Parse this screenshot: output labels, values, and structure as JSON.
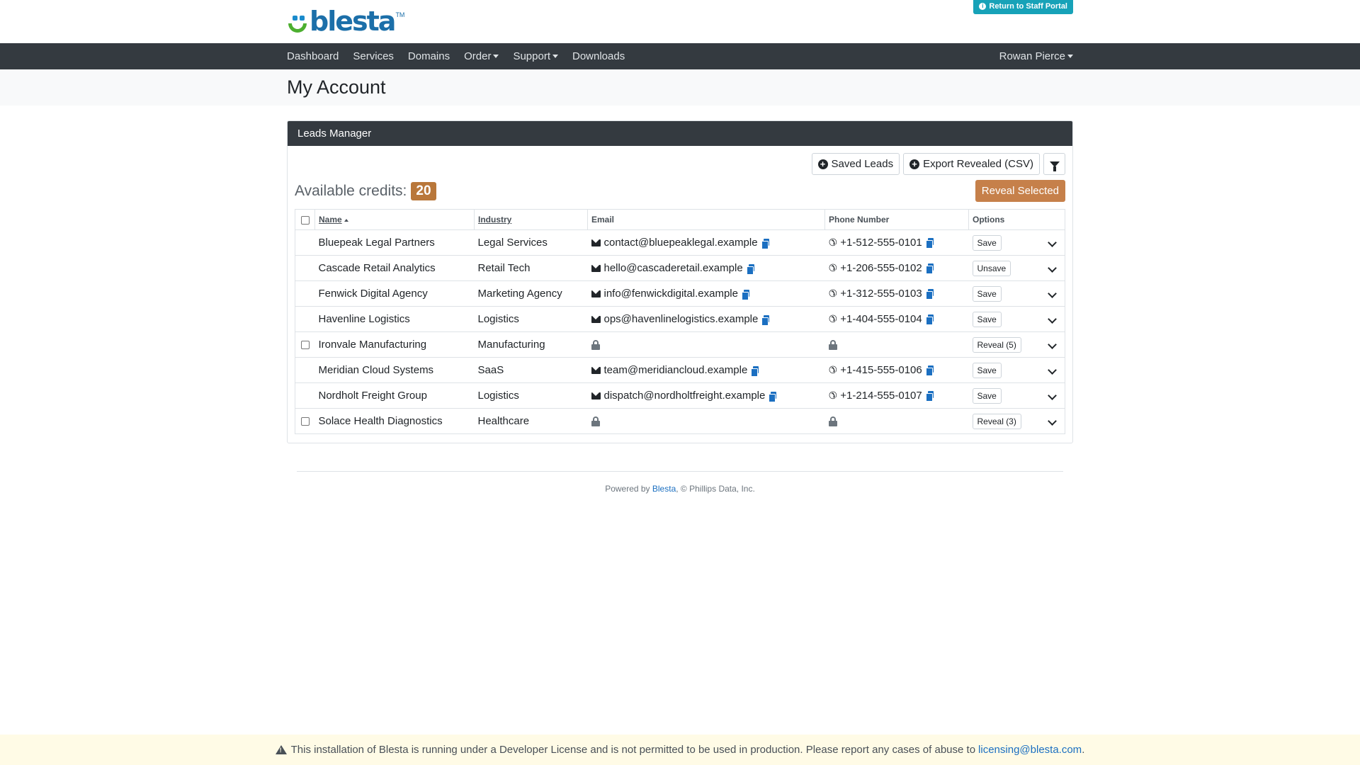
{
  "brand": {
    "name": "blesta",
    "tm": "TM"
  },
  "header": {
    "staff_button": "Return to Staff Portal"
  },
  "nav": {
    "items": [
      "Dashboard",
      "Services",
      "Domains",
      "Order",
      "Support",
      "Downloads"
    ],
    "user": "Rowan Pierce"
  },
  "page": {
    "title": "My Account"
  },
  "leads": {
    "card_title": "Leads Manager",
    "saved_leads": "Saved Leads",
    "export": "Export Revealed (CSV)",
    "credits_label": "Available credits:",
    "credits_value": "20",
    "reveal_selected": "Reveal Selected",
    "columns": {
      "name": "Name",
      "industry": "Industry",
      "email": "Email",
      "phone": "Phone Number",
      "options": "Options"
    },
    "rows": [
      {
        "name": "Bluepeak Legal Partners",
        "industry": "Legal Services",
        "email": "contact@bluepeaklegal.example",
        "phone": "+1-512-555-0101",
        "action": "Save",
        "locked": false
      },
      {
        "name": "Cascade Retail Analytics",
        "industry": "Retail Tech",
        "email": "hello@cascaderetail.example",
        "phone": "+1-206-555-0102",
        "action": "Unsave",
        "locked": false
      },
      {
        "name": "Fenwick Digital Agency",
        "industry": "Marketing Agency",
        "email": "info@fenwickdigital.example",
        "phone": "+1-312-555-0103",
        "action": "Save",
        "locked": false
      },
      {
        "name": "Havenline Logistics",
        "industry": "Logistics",
        "email": "ops@havenlinelogistics.example",
        "phone": "+1-404-555-0104",
        "action": "Save",
        "locked": false
      },
      {
        "name": "Ironvale Manufacturing",
        "industry": "Manufacturing",
        "email": "",
        "phone": "",
        "action": "Reveal (5)",
        "locked": true
      },
      {
        "name": "Meridian Cloud Systems",
        "industry": "SaaS",
        "email": "team@meridiancloud.example",
        "phone": "+1-415-555-0106",
        "action": "Save",
        "locked": false
      },
      {
        "name": "Nordholt Freight Group",
        "industry": "Logistics",
        "email": "dispatch@nordholtfreight.example",
        "phone": "+1-214-555-0107",
        "action": "Save",
        "locked": false
      },
      {
        "name": "Solace Health Diagnostics",
        "industry": "Healthcare",
        "email": "",
        "phone": "",
        "action": "Reveal (3)",
        "locked": true
      }
    ]
  },
  "footer": {
    "powered_prefix": "Powered by ",
    "powered_link": "Blesta",
    "powered_suffix": ", © Phillips Data, Inc."
  },
  "dev_notice": {
    "text": "This installation of Blesta is running under a Developer License and is not permitted to be used in production. Please report any cases of abuse to",
    "email": "licensing@blesta.com",
    "end": "."
  },
  "colors": {
    "nav_bg": "#343a40",
    "accent": "#c6804a",
    "info": "#17a2b8",
    "link": "#1b6fc1"
  },
  "icons": [
    "info-icon",
    "plus-circle-icon",
    "filter-icon",
    "envelope-icon",
    "phone-icon",
    "copy-icon",
    "lock-icon",
    "chevron-down-icon",
    "warning-icon"
  ]
}
